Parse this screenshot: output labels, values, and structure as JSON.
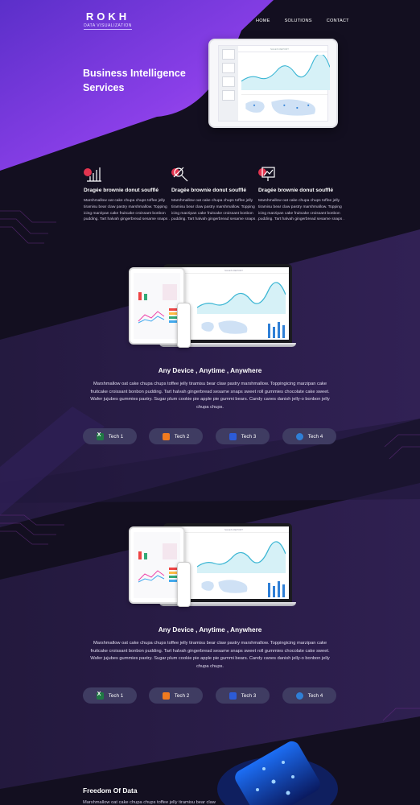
{
  "brand": {
    "name": "ROKH",
    "tagline": "DATA VISUALIZATION"
  },
  "nav": {
    "items": [
      "HOME",
      "SOLUTIONS",
      "CONTACT"
    ]
  },
  "hero": {
    "title": "Business Intelligence Services",
    "dashboard_label": "SALES REPORT"
  },
  "features": [
    {
      "icon": "bar-chart-icon",
      "title": "Dragée brownie donut soufflé",
      "text": "Marshmallow oat cake chupa chups toffee jelly tiramisu bear claw pastry marshmallow. Topping icing marzipan cake fruitcake croissant bonbon pudding. Tart halvah gingerbread sesame snaps ."
    },
    {
      "icon": "magnifier-icon",
      "title": "Dragée brownie donut soufflé",
      "text": "Marshmallow oat cake chupa chups toffee jelly tiramisu bear claw pastry marshmallow. Topping icing marzipan cake fruitcake croissant bonbon pudding. Tart halvah gingerbread sesame snaps ."
    },
    {
      "icon": "presentation-icon",
      "title": "Dragée brownie donut soufflé",
      "text": "Marshmallow oat cake chupa chups toffee jelly tiramisu bear claw pastry marshmallow. Topping icing marzipan cake fruitcake croissant bonbon pudding. Tart halvah gingerbread sesame snaps ."
    }
  ],
  "sections": [
    {
      "title": "Any Device , Anytime , Anywhere",
      "text": "Marshmallow oat cake chupa chups toffee jelly tiramisu bear claw pastry marshmallow. Toppingicing marzipan cake fruitcake croissant bonbon pudding. Tart halvah gingerbread sesame snaps sweet roll gummies chocolate cake sweet. Wafer jujubes gummies pastry. Sugar plum cookie pie apple pie gummi bears. Candy canes danish jelly-o bonbon jelly chupa chups.",
      "screen_label": "SALES REPORT"
    },
    {
      "title": "Any Device , Anytime , Anywhere",
      "text": "Marshmallow oat cake chupa chups toffee jelly tiramisu bear claw pastry marshmallow. Toppingicing marzipan cake fruitcake croissant bonbon pudding. Tart halvah gingerbread sesame snaps sweet roll gummies chocolate cake sweet. Wafer jujubes gummies pastry. Sugar plum cookie pie apple pie gummi bears. Candy canes danish jelly-o bonbon jelly chupa chups.",
      "screen_label": "SALES REPORT"
    }
  ],
  "tech_buttons": [
    {
      "label": "Tech 1",
      "icon": "excel-icon",
      "color": "#1f7a44"
    },
    {
      "label": "Tech 2",
      "icon": "chart-icon",
      "color": "#f07a1f"
    },
    {
      "label": "Tech 3",
      "icon": "database-icon",
      "color": "#2c5bd8"
    },
    {
      "label": "Tech 4",
      "icon": "cloud-icon",
      "color": "#2f7fd6"
    }
  ],
  "freedom": {
    "title": "Freedom Of Data",
    "text": "Marshmallow oat cake chupa chups toffee jelly tiramisu bear claw"
  },
  "colors": {
    "accent": "#6c3ef0",
    "background": "#130f20",
    "button": "#3f3c62",
    "feature_icon": "#e3344f"
  }
}
